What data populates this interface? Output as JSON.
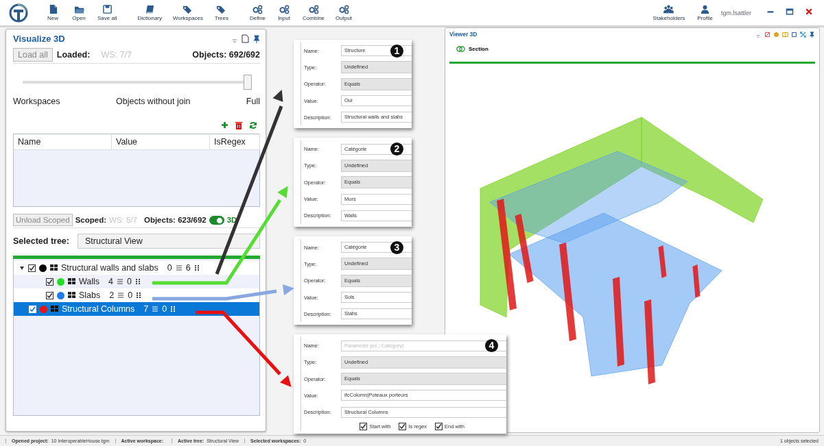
{
  "toolbar": {
    "groups": [
      [
        {
          "label": "New",
          "kind": "file"
        },
        {
          "label": "Open",
          "kind": "folder"
        },
        {
          "label": "Save all",
          "kind": "save"
        }
      ],
      [
        {
          "label": "Dictionary",
          "kind": "book"
        },
        {
          "label": "Workspaces",
          "kind": "tags"
        },
        {
          "label": "Trees",
          "kind": "tags"
        }
      ],
      [
        {
          "label": "Define",
          "kind": "gears"
        },
        {
          "label": "Input",
          "kind": "gears"
        },
        {
          "label": "Combine",
          "kind": "gears"
        },
        {
          "label": "Output",
          "kind": "gears"
        }
      ]
    ],
    "right_buttons": [
      {
        "label": "Stakeholders",
        "kind": "people"
      },
      {
        "label": "Profile",
        "kind": "person"
      }
    ],
    "user": "tgm.lsattler"
  },
  "visualize_panel": {
    "title": "Visualize 3D",
    "load_all_button": "Load all",
    "loaded_label": "Loaded:",
    "loaded_ws": "WS: 7/7",
    "loaded_objects": "Objects: 692/692",
    "slider": {
      "level": 1
    },
    "slider_labels": [
      "Workspaces",
      "Objects without join",
      "Full"
    ],
    "table": {
      "columns": [
        "Name",
        "Value",
        "IsRegex"
      ]
    },
    "unload_button": "Unload Scoped",
    "scoped_label": "Scoped:",
    "scoped_ws": "WS: 5/7",
    "scoped_objects": "Objects: 623/692",
    "toggle_3d": {
      "label": "3D",
      "on": true
    },
    "selected_tree_label": "Selected tree:",
    "selected_tree": "Structural View",
    "tree": [
      {
        "name": "Structural walls and slabs",
        "count_a": "0",
        "count_b": "6",
        "checked": true,
        "expanded": true,
        "selected": false,
        "color": "#000000",
        "children": [
          {
            "name": "Walls",
            "count_a": "4",
            "count_b": "0",
            "checked": true,
            "selected": false,
            "color": "#22dd22"
          },
          {
            "name": "Slabs",
            "count_a": "2",
            "count_b": "0",
            "checked": true,
            "selected": false,
            "color": "#1e7be8"
          }
        ]
      },
      {
        "name": "Structural Columns",
        "count_a": "7",
        "count_b": "0",
        "checked": true,
        "selected": true,
        "color": "#ee1111"
      }
    ]
  },
  "filter_cards": [
    {
      "number": "1",
      "fields": [
        {
          "label": "Name:",
          "kind": "text",
          "value": "Structure"
        },
        {
          "label": "Type:",
          "kind": "select",
          "value": "Undefined"
        },
        {
          "label": "Operator:",
          "kind": "select",
          "value": "Equals"
        },
        {
          "label": "Value:",
          "kind": "text",
          "value": "Oui"
        },
        {
          "label": "Description:",
          "kind": "text",
          "value": "Structural walls and slabs"
        }
      ]
    },
    {
      "number": "2",
      "fields": [
        {
          "label": "Name:",
          "kind": "text",
          "value": "Catégorie"
        },
        {
          "label": "Type:",
          "kind": "select",
          "value": "Undefined"
        },
        {
          "label": "Operator:",
          "kind": "select",
          "value": "Equals"
        },
        {
          "label": "Value:",
          "kind": "text",
          "value": "Murs"
        },
        {
          "label": "Description:",
          "kind": "text",
          "value": "Walls"
        }
      ]
    },
    {
      "number": "3",
      "fields": [
        {
          "label": "Name:",
          "kind": "text",
          "value": "Catégorie"
        },
        {
          "label": "Type:",
          "kind": "select",
          "value": "Undefined"
        },
        {
          "label": "Operator:",
          "kind": "select",
          "value": "Equals"
        },
        {
          "label": "Value:",
          "kind": "text",
          "value": "Sols"
        },
        {
          "label": "Description:",
          "kind": "text",
          "value": "Slabs"
        }
      ]
    },
    {
      "number": "4",
      "fields": [
        {
          "label": "Name:",
          "kind": "text",
          "placeholder": "Parameter (ex : Category)"
        },
        {
          "label": "Type:",
          "kind": "select",
          "value": "Undefined"
        },
        {
          "label": "Operator:",
          "kind": "select",
          "value": "Equals"
        },
        {
          "label": "Value:",
          "kind": "text",
          "value": "ifcColumn|Poteaux porteurs"
        },
        {
          "label": "Description:",
          "kind": "text",
          "value": "Structural Columns"
        }
      ],
      "options": [
        {
          "label": "Start with",
          "checked": true
        },
        {
          "label": "Is regex",
          "checked": true
        },
        {
          "label": "End with",
          "checked": true
        }
      ]
    }
  ],
  "viewer": {
    "title": "Viewer 3D",
    "section_label": "Section"
  },
  "status_bar": {
    "items": [
      {
        "label": "Opened project:",
        "value": "10 InteroperableHouse.tgm"
      },
      {
        "label": "Active workspace:"
      },
      {
        "label": "Active tree:",
        "value": "Structural View"
      },
      {
        "label": "Selected workspaces:",
        "value": "0"
      }
    ],
    "right": "1 objects selected"
  }
}
